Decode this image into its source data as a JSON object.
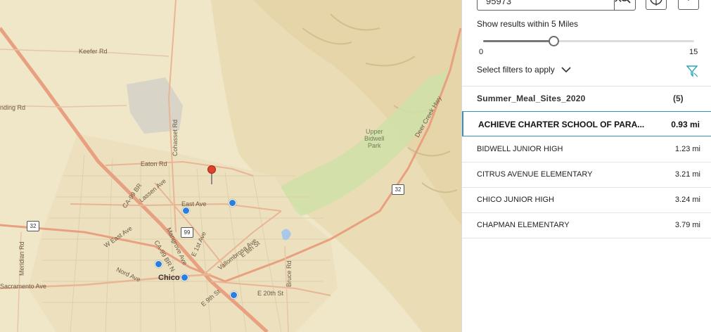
{
  "map": {
    "roads": {
      "keefer": "Keefer Rd",
      "landing": "nding Rd",
      "cohasset": "Cohasset Rd",
      "eaton": "Eaton Rd",
      "lassen": "Lassen Ave",
      "east_ave": "East Ave",
      "ca99br": "CA-99 BR",
      "w_east": "W East Ave",
      "mangrove": "Mangrove Ave",
      "e1st": "E 1st Ave",
      "vallombrosa": "Vallombrosa Ave",
      "e8th": "E 8th St",
      "ca99brn": "CA-99 BR N",
      "meridian": "Meridian Rd",
      "nord": "Nord Ave",
      "sacramento": "Sacramento Ave",
      "e9th": "E 9th St",
      "e20th": "E 20th St",
      "bruce": "Bruce Rd",
      "deer_creek": "Deer Creek Hwy"
    },
    "city": "Chico",
    "park": [
      "Upper",
      "Bidwell",
      "Park"
    ],
    "shields": {
      "r32a": "32",
      "r32b": "32",
      "r99": "99"
    }
  },
  "search": {
    "value": "95973",
    "clear_icon": "close-icon",
    "search_icon": "search-icon"
  },
  "toolbar": {
    "locate_icon": "locate-icon",
    "favorite_icon": "heart-icon"
  },
  "distance": {
    "label": "Show results within 5 Miles",
    "value": 5,
    "min_label": "0",
    "max_label": "15",
    "min": 0,
    "max": 15
  },
  "filters": {
    "label": "Select filters to apply",
    "icon": "filter-icon"
  },
  "layer": {
    "title": "Summer_Meal_Sites_2020",
    "count": "(5)"
  },
  "results": [
    {
      "name": "ACHIEVE CHARTER SCHOOL OF PARA...",
      "distance": "0.93 mi",
      "selected": true
    },
    {
      "name": "BIDWELL JUNIOR HIGH",
      "distance": "1.23 mi",
      "selected": false
    },
    {
      "name": "CITRUS AVENUE ELEMENTARY",
      "distance": "3.21 mi",
      "selected": false
    },
    {
      "name": "CHICO JUNIOR HIGH",
      "distance": "3.24 mi",
      "selected": false
    },
    {
      "name": "CHAPMAN ELEMENTARY",
      "distance": "3.79 mi",
      "selected": false
    }
  ],
  "colors": {
    "map_bg": "#f0e6c8",
    "park": "#cfe0a8",
    "highway": "#e8a080",
    "accent": "#3a8fbf",
    "marker": "#2a7fdc",
    "pin": "#e0412a"
  }
}
